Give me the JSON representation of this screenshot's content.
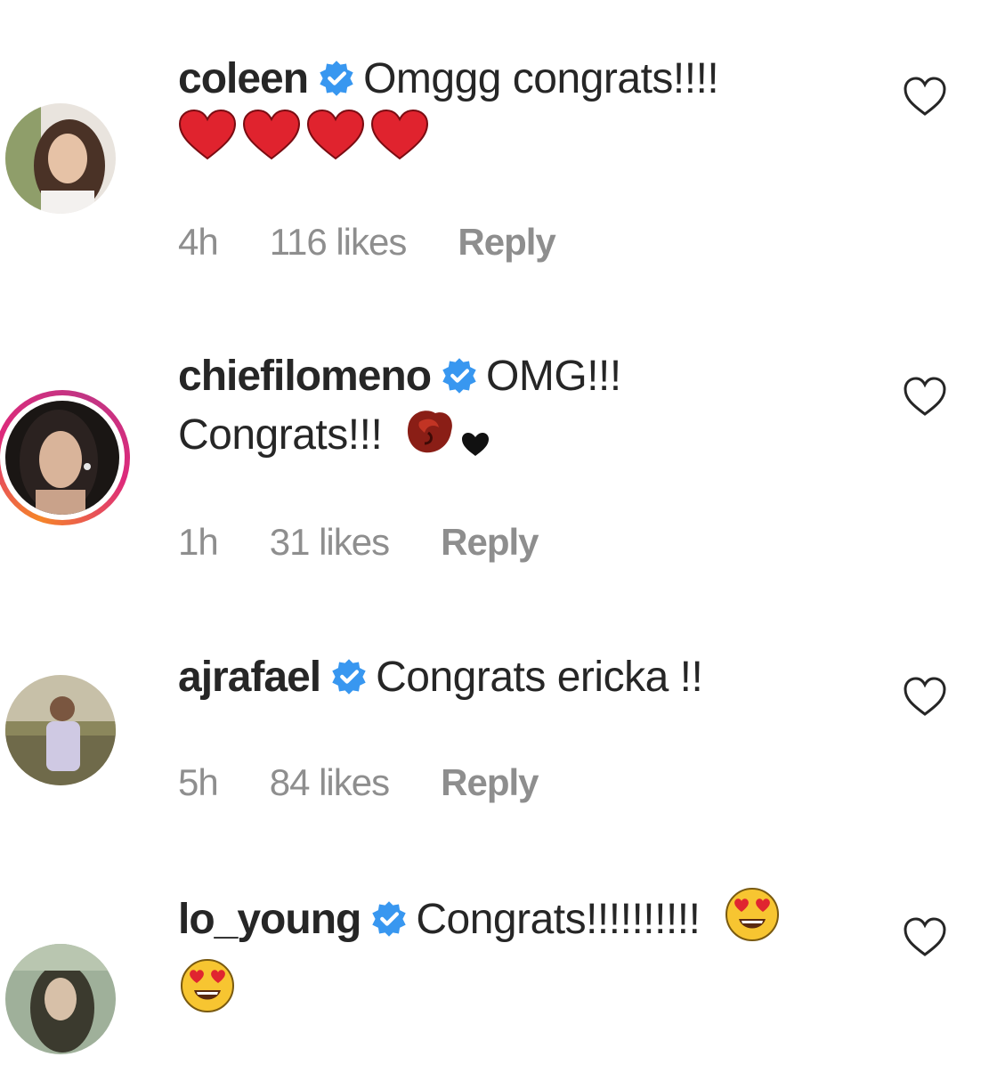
{
  "comments": [
    {
      "username": "coleen",
      "text": "Omggg congrats!!!!",
      "emojis": [
        "red-heart",
        "red-heart",
        "red-heart",
        "red-heart"
      ],
      "time": "4h",
      "likes": "116 likes",
      "reply_label": "Reply",
      "verified": true
    },
    {
      "username": "chiefilomeno",
      "text": "OMG!!!",
      "text2": "Congrats!!!",
      "emojis": [
        "rose",
        "black-heart"
      ],
      "time": "1h",
      "likes": "31 likes",
      "reply_label": "Reply",
      "verified": true,
      "has_story": true
    },
    {
      "username": "ajrafael",
      "text": "Congrats ericka !!",
      "emojis": [],
      "time": "5h",
      "likes": "84 likes",
      "reply_label": "Reply",
      "verified": true
    },
    {
      "username": "lo_young",
      "text": "Congrats!!!!!!!!!!",
      "emojis": [
        "heart-eyes-face",
        "heart-eyes-face"
      ],
      "time": "",
      "likes": "",
      "reply_label": "",
      "verified": true
    }
  ],
  "colors": {
    "text": "#262626",
    "meta": "#8e8e8e",
    "verified_badge": "#3897f0",
    "story_ring_start": "#f58529",
    "story_ring_end": "#c13584"
  },
  "icons": {
    "verified": "verified-badge-icon",
    "like": "heart-outline-icon"
  }
}
